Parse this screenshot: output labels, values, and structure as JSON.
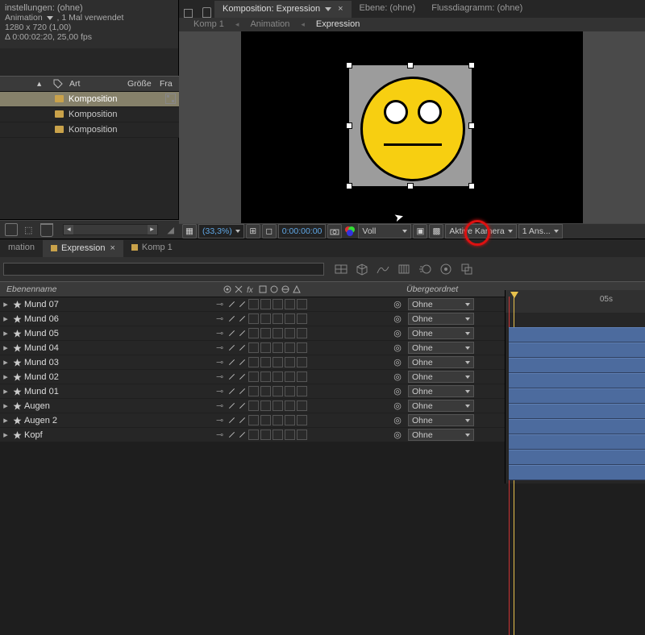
{
  "project": {
    "settings_title": "instellungen: (ohne)",
    "anim_label": "Animation",
    "usage": ", 1 Mal verwendet",
    "resolution": "1280 x 720 (1,00)",
    "duration": "Δ 0:00:02:20, 25,00 fps",
    "col_name": "Art",
    "col_size": "Größe",
    "col_fr": "Fra",
    "items": [
      {
        "label": "Komposition",
        "selected": true
      },
      {
        "label": "Komposition",
        "selected": false
      },
      {
        "label": "Komposition",
        "selected": false
      }
    ]
  },
  "comp_tabs": {
    "active_prefix": "Komposition:",
    "active_name": "Expression",
    "tab2": "Ebene: (ohne)",
    "tab3": "Flussdiagramm: (ohne)"
  },
  "breadcrumb": {
    "c1": "Komp 1",
    "c2": "Animation",
    "c3": "Expression"
  },
  "comp_toolbar": {
    "zoom": "(33,3%)",
    "timecode": "0:00:00:00",
    "quality": "Voll",
    "camera": "Aktive Kamera",
    "views": "1 Ans..."
  },
  "timeline_tabs": {
    "t1": "mation",
    "t2": "Expression",
    "t3": "Komp 1"
  },
  "ruler_05s": "05s",
  "columns": {
    "layer_name": "Ebenenname",
    "parent": "Übergeordnet"
  },
  "parent_none": "Ohne",
  "layers": [
    {
      "name": "Mund 07"
    },
    {
      "name": "Mund 06"
    },
    {
      "name": "Mund 05"
    },
    {
      "name": "Mund 04"
    },
    {
      "name": "Mund 03"
    },
    {
      "name": "Mund 02"
    },
    {
      "name": "Mund 01"
    },
    {
      "name": "Augen"
    },
    {
      "name": "Augen 2"
    },
    {
      "name": "Kopf"
    }
  ]
}
